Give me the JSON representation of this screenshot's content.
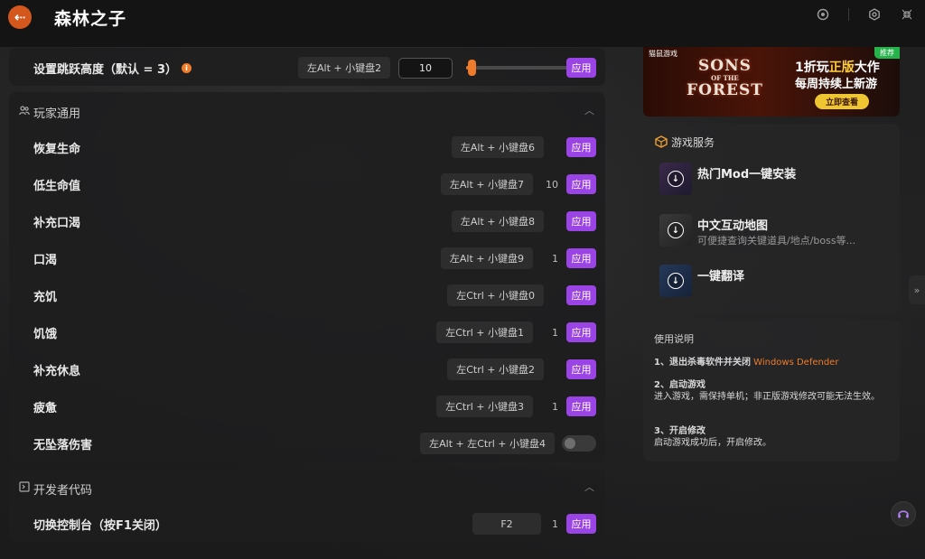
{
  "app": {
    "title": "森林之子",
    "back_icon": "arrow-left-icon"
  },
  "window_controls": [
    "settings-gear-icon",
    "minimize-icon",
    "close-icon"
  ],
  "jump": {
    "label": "设置跳跃高度（默认 = 3）",
    "info": "i",
    "hotkey": "左Alt + 小键盘2",
    "value": "10",
    "slider_fraction": 0.05,
    "apply": "应用"
  },
  "player": {
    "title": "玩家通用",
    "rows": [
      {
        "label": "恢复生命",
        "hotkey": "左Alt + 小键盘6",
        "value": "",
        "apply": "应用"
      },
      {
        "label": "低生命值",
        "hotkey": "左Alt + 小键盘7",
        "value": "10",
        "apply": "应用"
      },
      {
        "label": "补充口渴",
        "hotkey": "左Alt + 小键盘8",
        "value": "",
        "apply": "应用"
      },
      {
        "label": "口渴",
        "hotkey": "左Alt + 小键盘9",
        "value": "1",
        "apply": "应用"
      },
      {
        "label": "充饥",
        "hotkey": "左Ctrl + 小键盘0",
        "value": "",
        "apply": "应用"
      },
      {
        "label": "饥饿",
        "hotkey": "左Ctrl + 小键盘1",
        "value": "1",
        "apply": "应用"
      },
      {
        "label": "补充休息",
        "hotkey": "左Ctrl + 小键盘2",
        "value": "",
        "apply": "应用"
      },
      {
        "label": "疲惫",
        "hotkey": "左Ctrl + 小键盘3",
        "value": "1",
        "apply": "应用"
      }
    ],
    "nofall": {
      "label": "无坠落伤害",
      "hotkey": "左Alt + 左Ctrl + 小键盘4",
      "toggle_on": false
    }
  },
  "dev": {
    "title": "开发者代码",
    "row": {
      "label": "切换控制台（按F1关闭）",
      "hotkey": "F2",
      "value": "1",
      "apply": "应用"
    }
  },
  "banner": {
    "brand": "猫鼠游戏",
    "tag": "推荐",
    "logo_line1": "SONS",
    "logo_line2": "FOREST",
    "logo_of": "OF THE",
    "line1_pre": "1折玩",
    "line1_hl": "正版",
    "line1_post": "大作",
    "line2": "每周持续上新游",
    "button": "立即查看"
  },
  "services": {
    "title": "游戏服务",
    "items": [
      {
        "name": "热门Mod一键安装",
        "desc": ""
      },
      {
        "name": "中文互动地图",
        "desc": "可便捷查询关键道具/地点/boss等..."
      },
      {
        "name": "一键翻译",
        "desc": ""
      }
    ]
  },
  "usage": {
    "title": "使用说明",
    "step1_pre": "1、退出杀毒软件并关闭",
    "step1_hl": "Windows Defender",
    "step2_title": "2、启动游戏",
    "step2_text": "进入游戏，需保持单机；非正版游戏修改可能无法生效。",
    "step3_title": "3、开启修改",
    "step3_text": "启动游戏成功后，开启修改。"
  },
  "colors": {
    "accent_purple": "#9b44e6",
    "accent_orange": "#ef7d2a"
  }
}
